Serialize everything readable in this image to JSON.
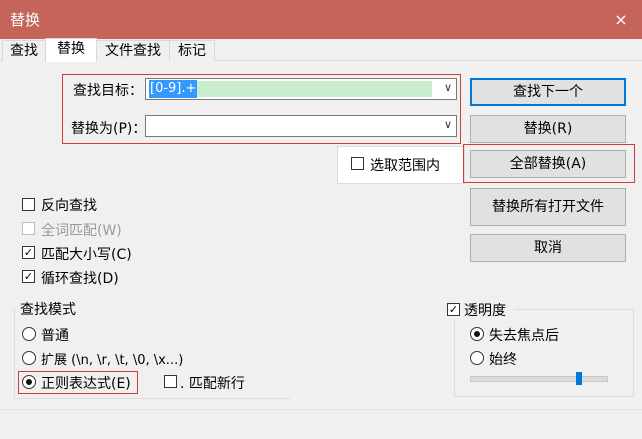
{
  "window": {
    "title": "替换",
    "close_glyph": "×"
  },
  "tabs": [
    {
      "label": "查找"
    },
    {
      "label": "替换"
    },
    {
      "label": "文件查找"
    },
    {
      "label": "标记"
    }
  ],
  "find": {
    "label": "查找目标：",
    "value": "[0-9].+"
  },
  "replace": {
    "label": "替换为(P)：",
    "value": ""
  },
  "in_selection": {
    "label": "选取范围内",
    "checked": false
  },
  "buttons": {
    "find_next": "查找下一个",
    "replace": "替换(R)",
    "replace_all": "全部替换(A)",
    "replace_all_open": "替换所有打开文件",
    "cancel": "取消"
  },
  "options": [
    {
      "label": "反向查找",
      "checked": false,
      "disabled": false
    },
    {
      "label": "全词匹配(W)",
      "checked": false,
      "disabled": true
    },
    {
      "label": "匹配大小写(C)",
      "checked": true,
      "disabled": false
    },
    {
      "label": "循环查找(D)",
      "checked": true,
      "disabled": false
    }
  ],
  "search_mode": {
    "title": "查找模式",
    "normal": "普通",
    "extended": "扩展 (\\n, \\r, \\t, \\0, \\x...)",
    "regex": "正则表达式(E)",
    "dot_newline": ". 匹配新行",
    "selected": "regex"
  },
  "transparency": {
    "label": "透明度",
    "checked": true,
    "on_lose_focus": "失去焦点后",
    "always": "始终",
    "selected": "on_lose_focus",
    "level": 0.8
  },
  "colors": {
    "title_bar": "#c4645a",
    "highlight": "#d03b3b",
    "accent": "#0078d7"
  }
}
